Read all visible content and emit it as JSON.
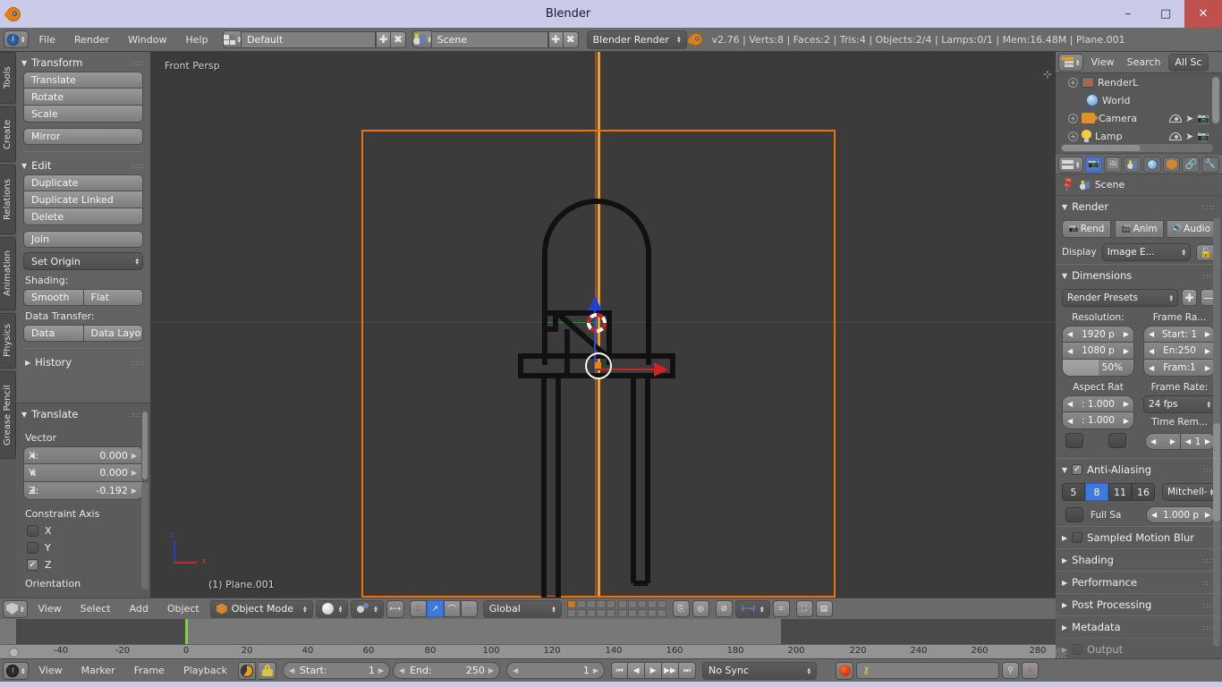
{
  "window": {
    "title": "Blender",
    "app_icon": "blender-logo-icon",
    "minimize": "–",
    "maximize": "□",
    "close": "✕"
  },
  "info_header": {
    "editor_icon": "info-editor-icon",
    "menus": [
      "File",
      "Render",
      "Window",
      "Help"
    ],
    "screen_layout": {
      "icon": "screen-layout-icon",
      "value": "Default",
      "add": "✚",
      "remove": "✖"
    },
    "scene": {
      "icon": "scene-icon",
      "value": "Scene",
      "add": "✚",
      "remove": "✖"
    },
    "render_engine": "Blender Render",
    "status": "v2.76 | Verts:8 | Faces:2 | Tris:4 | Objects:2/4 | Lamps:0/1 | Mem:16.48M | Plane.001"
  },
  "toolshelf": {
    "tabs": [
      "Tools",
      "Create",
      "Relations",
      "Animation",
      "Physics",
      "Grease Pencil"
    ],
    "panels": [
      {
        "title": "Transform",
        "buttons": [
          "Translate",
          "Rotate",
          "Scale"
        ],
        "buttons2": [
          "Mirror"
        ]
      },
      {
        "title": "Edit",
        "buttons": [
          "Duplicate",
          "Duplicate Linked",
          "Delete"
        ],
        "buttons2": [
          "Join"
        ],
        "dropdown": "Set Origin",
        "shading_label": "Shading:",
        "shading": [
          "Smooth",
          "Flat"
        ],
        "data_transfer_label": "Data Transfer:",
        "data_transfer": [
          "Data",
          "Data Layo"
        ]
      },
      {
        "title": "History",
        "collapsed": true
      }
    ]
  },
  "redo_panel": {
    "title": "Translate",
    "vector_label": "Vector",
    "fields": [
      {
        "label": "X:",
        "value": "0.000"
      },
      {
        "label": "Y:",
        "value": "0.000"
      },
      {
        "label": "Z:",
        "value": "-0.192"
      }
    ],
    "constraint_label": "Constraint Axis",
    "axes": [
      {
        "label": "X",
        "checked": false
      },
      {
        "label": "Y",
        "checked": false
      },
      {
        "label": "Z",
        "checked": true
      }
    ],
    "orientation_label": "Orientation"
  },
  "viewport": {
    "view_name": "Front Persp",
    "object_name": "(1) Plane.001",
    "gizmo": {
      "z": "z",
      "x": "x"
    },
    "colors": {
      "background": "#3b3b3b",
      "camera_frame": "#f07000",
      "z_axis_line": "#f0a030",
      "grid_line": "#4b4b4b",
      "green_axis": "#2e8b3a",
      "manipulator_z": "#2040d6",
      "manipulator_x": "#d02020",
      "cursor": "#d02020",
      "origin": "#f08010"
    }
  },
  "viewport_header": {
    "editor_icon": "3d-view-editor-icon",
    "menus": [
      "View",
      "Select",
      "Add",
      "Object"
    ],
    "mode": {
      "icon": "object-mode-icon",
      "value": "Object Mode"
    },
    "shading": "solid-shading-icon",
    "pivot": "pivot-point-icon",
    "snap_proportional": "proportional-edit-icon",
    "manipulators": [
      "translate-manipulator-icon",
      "rotate-manipulator-icon",
      "scale-manipulator-icon"
    ],
    "transform_orientation": "Global",
    "layers": "scene-layers-grid",
    "extra_icons": [
      "lock-to-scene-icon",
      "render-only-icon",
      "snap-magnet-icon",
      "snap-mode-icon",
      "snap-target-icon",
      "render-preview-icon",
      "opengl-render-icon"
    ]
  },
  "timeline": {
    "ticks": [
      "-40",
      "-20",
      "0",
      "20",
      "40",
      "60",
      "80",
      "100",
      "120",
      "140",
      "160",
      "180",
      "200",
      "220",
      "240",
      "260",
      "280"
    ],
    "playhead_frame": 0,
    "header": {
      "editor_icon": "timeline-editor-icon",
      "menus": [
        "View",
        "Marker",
        "Frame",
        "Playback"
      ],
      "auto_key_icon": "auto-keying-icon",
      "lock_icon": "lock-icon",
      "start": {
        "label": "Start:",
        "value": "1"
      },
      "end": {
        "label": "End:",
        "value": "250"
      },
      "current_frame": "1",
      "transport": [
        "⏮",
        "◀",
        "▶",
        "▶▶",
        "⏭"
      ],
      "sync_mode": "No Sync",
      "record_icon": "record-icon",
      "keying_set_placeholder": "",
      "keying_icons": [
        "insert-keyframe-icon",
        "delete-keyframe-icon"
      ]
    }
  },
  "outliner": {
    "header": {
      "editor_icon": "outliner-editor-icon",
      "menus": [
        "View",
        "Search"
      ],
      "display_mode": "All Sc"
    },
    "rows": [
      {
        "icon": "render-layer-icon",
        "label": "RenderL",
        "indent": 10,
        "expand": "+",
        "restrict": []
      },
      {
        "icon": "world-icon",
        "label": "World",
        "indent": 20,
        "expand": "",
        "restrict": []
      },
      {
        "icon": "camera-icon",
        "label": "Camera",
        "indent": 10,
        "expand": "+",
        "restrict": [
          "eye-icon",
          "cursor-icon",
          "camera-render-icon"
        ]
      },
      {
        "icon": "lamp-icon",
        "label": "Lamp",
        "indent": 10,
        "expand": "+",
        "restrict": [
          "eye-icon",
          "cursor-icon",
          "camera-render-icon"
        ]
      }
    ]
  },
  "properties": {
    "header": {
      "editor_icon": "properties-editor-icon",
      "tabs": [
        "render-tab",
        "render-layers-tab",
        "scene-tab",
        "world-tab",
        "object-tab",
        "constraints-tab",
        "modifiers-tab"
      ],
      "selected_tab_index": 0
    },
    "breadcrumb": {
      "pin_icon": "pin-icon",
      "scene_icon": "scene-icon",
      "label": "Scene"
    },
    "sections": [
      {
        "title": "Render",
        "open": true,
        "buttons": [
          {
            "icon": "render-image-icon",
            "label": "Rend"
          },
          {
            "icon": "render-animation-icon",
            "label": "Anim"
          },
          {
            "icon": "render-audio-icon",
            "label": "Audio"
          }
        ],
        "display_label": "Display",
        "display_value": "Image E...",
        "display_lock_icon": "unlock-icon"
      },
      {
        "title": "Dimensions",
        "open": true,
        "presets": "Render Presets",
        "preset_add": "✚",
        "preset_remove": "—",
        "resolution_label": "Resolution:",
        "frame_range_label": "Frame Ra...",
        "resolution_x": "1920 p",
        "resolution_y": "1080 p",
        "resolution_percent": "50%",
        "frame_start": "Start: 1",
        "frame_end": "En:250",
        "frame_step": "Fram:1",
        "aspect_label": "Aspect Rat",
        "aspect_x": ": 1.000",
        "aspect_y": ": 1.000",
        "frame_rate_label": "Frame Rate:",
        "frame_rate": "24 fps",
        "time_remap_label": "Time Rem...",
        "time_remap_old": "",
        "time_remap_new": "1"
      },
      {
        "title": "Anti-Aliasing",
        "open": true,
        "checked": true,
        "samples": [
          "5",
          "8",
          "11",
          "16"
        ],
        "selected_sample_index": 1,
        "filter": "Mitchell-",
        "full_sample_label": "Full Sa",
        "full_sample_checked": false,
        "filter_size": "1.000 p"
      },
      {
        "title": "Sampled Motion Blur",
        "open": false,
        "checked": false
      },
      {
        "title": "Shading",
        "open": false
      },
      {
        "title": "Performance",
        "open": false
      },
      {
        "title": "Post Processing",
        "open": false
      },
      {
        "title": "Metadata",
        "open": false
      },
      {
        "title": "Output",
        "open": false
      }
    ]
  }
}
